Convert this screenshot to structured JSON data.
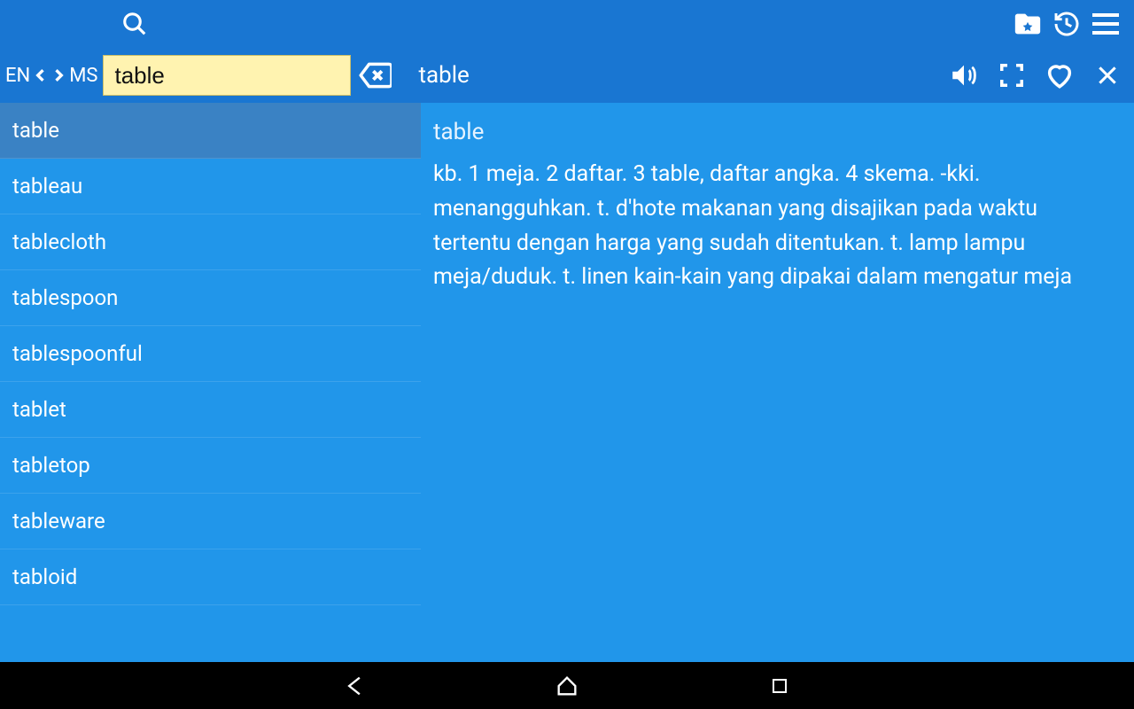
{
  "header": {
    "lang_from": "EN",
    "lang_to": "MS",
    "search_value": "table",
    "entry_title": "table"
  },
  "word_list": [
    "table",
    "tableau",
    "tablecloth",
    "tablespoon",
    "tablespoonful",
    "tablet",
    "tabletop",
    "tableware",
    "tabloid"
  ],
  "selected_index": 0,
  "definition": {
    "headword": "table",
    "body": "kb. 1 meja. 2 daftar. 3 table, daftar angka. 4 skema. -kki. menangguhkan. t. d'hote makanan yang disajikan pada waktu tertentu dengan harga yang sudah ditentukan. t. lamp lampu meja/duduk. t. linen kain-kain yang dipakai dalam mengatur meja"
  }
}
